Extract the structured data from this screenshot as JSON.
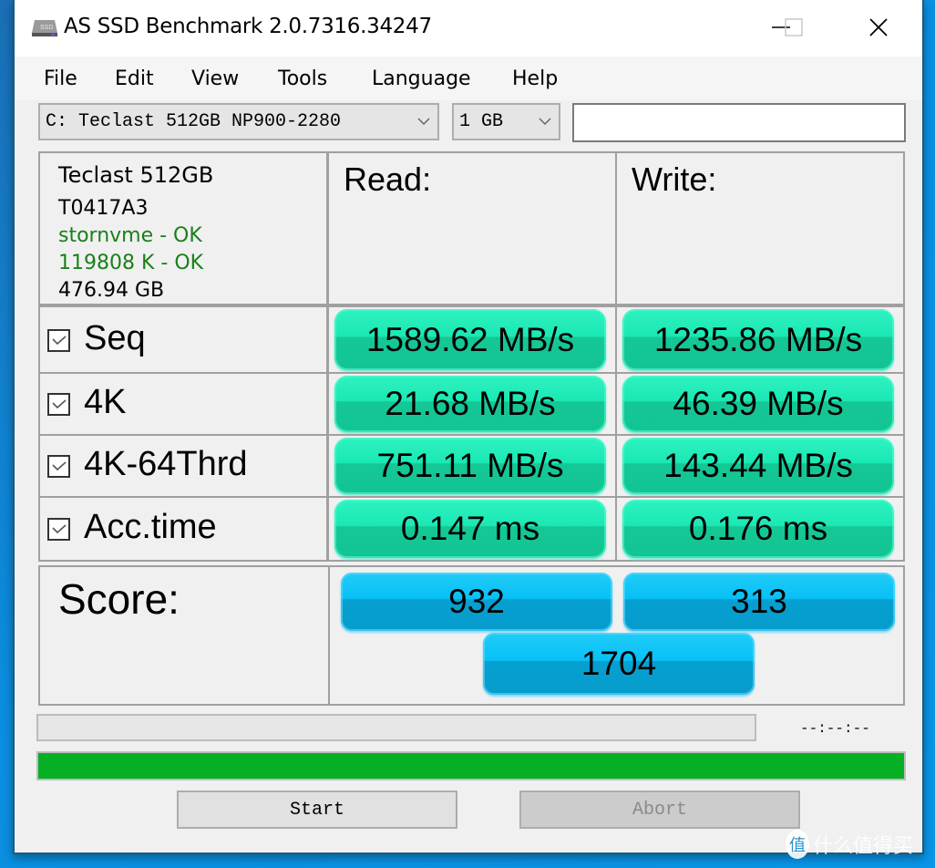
{
  "window": {
    "title": "AS SSD Benchmark 2.0.7316.34247",
    "controls": {
      "minimize": "minimize",
      "maximize": "maximize",
      "close": "close"
    }
  },
  "menu": [
    {
      "label": "File"
    },
    {
      "label": "Edit"
    },
    {
      "label": "View"
    },
    {
      "label": "Tools"
    },
    {
      "label": "Language"
    },
    {
      "label": "Help"
    }
  ],
  "toolbar": {
    "drive_select": "C: Teclast 512GB NP900-2280",
    "size_select": "1 GB",
    "text_field": ""
  },
  "drive_info": {
    "model": "Teclast 512GB",
    "firmware": "T0417A3",
    "driver": "stornvme - OK",
    "alignment": "119808 K - OK",
    "capacity": "476.94 GB",
    "ok_color": "#1a7f1a"
  },
  "columns": {
    "read": "Read:",
    "write": "Write:"
  },
  "tests": [
    {
      "label": "Seq",
      "checked": true,
      "read": "1589.62 MB/s",
      "write": "1235.86 MB/s"
    },
    {
      "label": "4K",
      "checked": true,
      "read": "21.68 MB/s",
      "write": "46.39 MB/s"
    },
    {
      "label": "4K-64Thrd",
      "checked": true,
      "read": "751.11 MB/s",
      "write": "143.44 MB/s"
    },
    {
      "label": "Acc.time",
      "checked": true,
      "read": "0.147 ms",
      "write": "0.176 ms"
    }
  ],
  "score": {
    "label": "Score:",
    "read": "932",
    "write": "313",
    "total": "1704"
  },
  "status": {
    "timer": "--:--:--",
    "progress_top": 0,
    "progress_main": 100,
    "progress_color": "#06b025"
  },
  "buttons": {
    "start": "Start",
    "abort": "Abort",
    "abort_enabled": false
  },
  "watermark": {
    "glyph": "值",
    "text": "什么值得买"
  }
}
